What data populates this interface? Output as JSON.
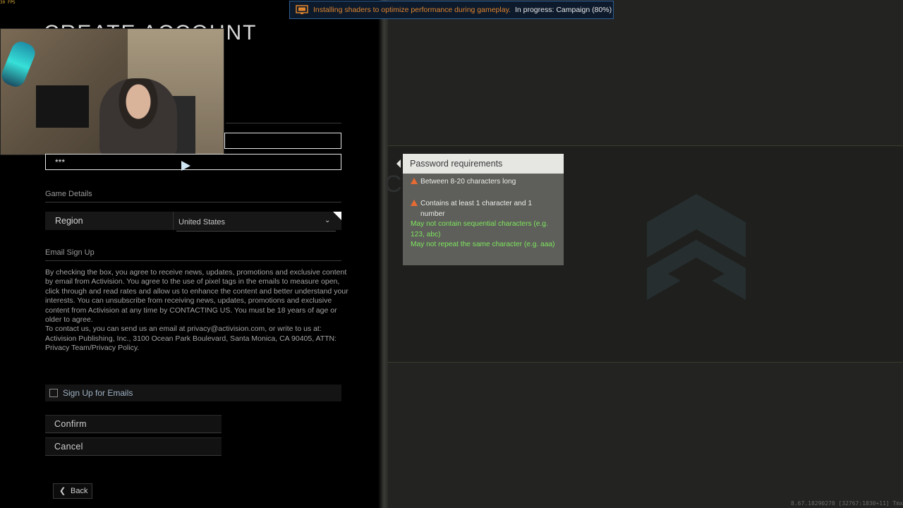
{
  "overlay": {
    "fps": "30 FPS",
    "banner_message": "Installing shaders to optimize performance during gameplay.",
    "banner_progress": "In progress: Campaign (80%)",
    "version_info": "8.67.18290278 [32767:1830+11] Tmx"
  },
  "page": {
    "title": "CREATE ACCOUNT"
  },
  "form": {
    "password_value": "***",
    "game_details_label": "Game Details",
    "region_label": "Region",
    "region_value": "United States",
    "email_signup_label": "Email Sign Up",
    "legal_text": "By checking the box, you agree to receive news, updates, promotions and exclusive content by email from Activision. You agree to the use of pixel tags in the emails to measure open, click through and read rates and allow us to enhance the content and better understand your interests. You can unsubscribe from receiving news, updates, promotions and exclusive content from Activision at any time by CONTACTING US. You must be 18 years of age or older to agree.",
    "contact_text": "To contact us, you can send us an email at privacy@activision.com, or write to us at: Activision Publishing, Inc., 3100 Ocean Park Boulevard, Santa Monica, CA 90405, ATTN: Privacy Team/Privacy Policy.",
    "signup_checkbox_label": "Sign Up for Emails",
    "signup_checked": false,
    "confirm_label": "Confirm",
    "cancel_label": "Cancel",
    "back_label": "Back"
  },
  "password_requirements": {
    "title": "Password requirements",
    "items": [
      {
        "text": "Between 8-20 characters long",
        "met": false
      },
      {
        "text": "Contains at least 1 character and 1 number",
        "met": false
      },
      {
        "text": "May not contain sequential characters (e.g. 123, abc)",
        "met": true
      },
      {
        "text": "May not repeat the same character (e.g. aaa)",
        "met": true
      }
    ]
  },
  "colors": {
    "banner_message": "#e0852d",
    "requirement_met": "#7ee55e",
    "requirement_warning": "#e66a33"
  },
  "icons": {
    "banner": "monitor-icon",
    "warning": "warning-icon",
    "back": "chevron-left-icon",
    "dropdown": "chevron-down-icon"
  }
}
